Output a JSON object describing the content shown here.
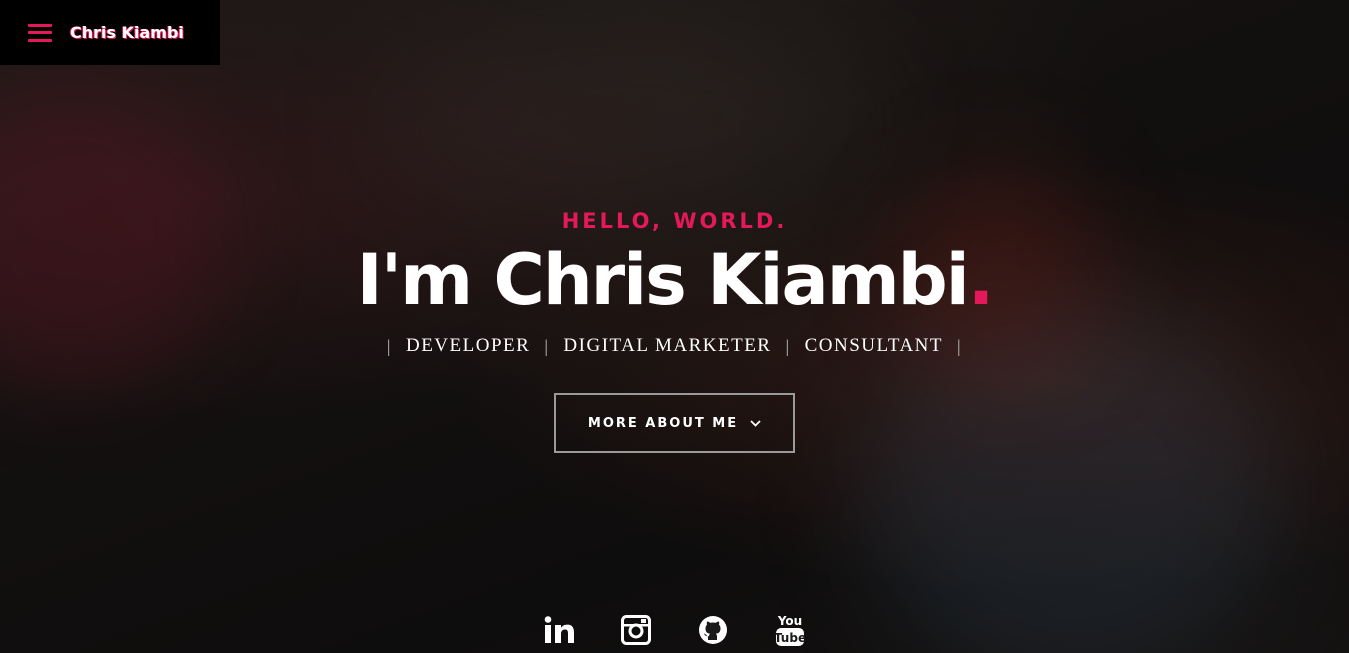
{
  "header": {
    "brand": "Chris Kiambi"
  },
  "hero": {
    "greeting": "HELLO, WORLD.",
    "name": "I'm Chris Kiambi",
    "name_dot": ".",
    "roles": [
      "DEVELOPER",
      "DIGITAL MARKETER",
      "CONSULTANT"
    ],
    "separator": "|",
    "cta_label": "MORE ABOUT ME"
  },
  "socials": [
    {
      "icon": "linkedin-icon"
    },
    {
      "icon": "instagram-icon"
    },
    {
      "icon": "github-icon"
    },
    {
      "icon": "youtube-icon"
    }
  ],
  "colors": {
    "accent": "#e5195a",
    "text": "#ffffff",
    "topbar": "#000000"
  }
}
